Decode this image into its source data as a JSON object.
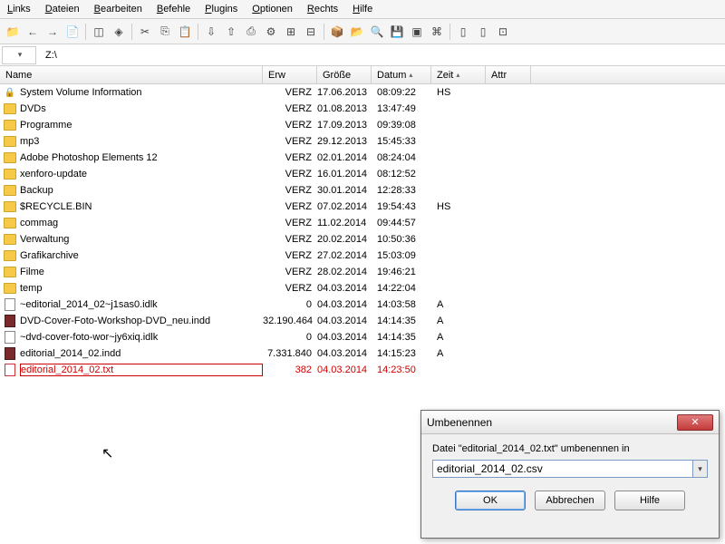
{
  "menu": [
    "Links",
    "Dateien",
    "Bearbeiten",
    "Befehle",
    "Plugins",
    "Optionen",
    "Rechts",
    "Hilfe"
  ],
  "drive": {
    "label": "",
    "path": "Z:\\"
  },
  "columns": {
    "name": "Name",
    "erw": "Erw",
    "size": "Größe",
    "date": "Datum",
    "time": "Zeit",
    "attr": "Attr"
  },
  "rows": [
    {
      "icon": "lock",
      "name": "System Volume Information",
      "size": "VERZ",
      "date": "17.06.2013",
      "time": "08:09:22",
      "attr": "HS"
    },
    {
      "icon": "folder",
      "name": "DVDs",
      "size": "VERZ",
      "date": "01.08.2013",
      "time": "13:47:49",
      "attr": ""
    },
    {
      "icon": "folder",
      "name": "Programme",
      "size": "VERZ",
      "date": "17.09.2013",
      "time": "09:39:08",
      "attr": ""
    },
    {
      "icon": "folder",
      "name": "mp3",
      "size": "VERZ",
      "date": "29.12.2013",
      "time": "15:45:33",
      "attr": ""
    },
    {
      "icon": "folder",
      "name": "Adobe Photoshop Elements 12",
      "size": "VERZ",
      "date": "02.01.2014",
      "time": "08:24:04",
      "attr": ""
    },
    {
      "icon": "folder",
      "name": "xenforo-update",
      "size": "VERZ",
      "date": "16.01.2014",
      "time": "08:12:52",
      "attr": ""
    },
    {
      "icon": "folder",
      "name": "Backup",
      "size": "VERZ",
      "date": "30.01.2014",
      "time": "12:28:33",
      "attr": ""
    },
    {
      "icon": "folder",
      "name": "$RECYCLE.BIN",
      "size": "VERZ",
      "date": "07.02.2014",
      "time": "19:54:43",
      "attr": "HS"
    },
    {
      "icon": "folder",
      "name": "commag",
      "size": "VERZ",
      "date": "11.02.2014",
      "time": "09:44:57",
      "attr": ""
    },
    {
      "icon": "folder",
      "name": "Verwaltung",
      "size": "VERZ",
      "date": "20.02.2014",
      "time": "10:50:36",
      "attr": ""
    },
    {
      "icon": "folder",
      "name": "Grafikarchive",
      "size": "VERZ",
      "date": "27.02.2014",
      "time": "15:03:09",
      "attr": ""
    },
    {
      "icon": "folder",
      "name": "Filme",
      "size": "VERZ",
      "date": "28.02.2014",
      "time": "19:46:21",
      "attr": ""
    },
    {
      "icon": "folder",
      "name": "temp",
      "size": "VERZ",
      "date": "04.03.2014",
      "time": "14:22:04",
      "attr": ""
    },
    {
      "icon": "file",
      "name": "~editorial_2014_02~j1sas0.idlk",
      "size": "0",
      "date": "04.03.2014",
      "time": "14:03:58",
      "attr": "A"
    },
    {
      "icon": "indd",
      "name": "DVD-Cover-Foto-Workshop-DVD_neu.indd",
      "size": "32.190.464",
      "date": "04.03.2014",
      "time": "14:14:35",
      "attr": "A"
    },
    {
      "icon": "file",
      "name": "~dvd-cover-foto-wor~jy6xiq.idlk",
      "size": "0",
      "date": "04.03.2014",
      "time": "14:14:35",
      "attr": "A"
    },
    {
      "icon": "indd",
      "name": "editorial_2014_02.indd",
      "size": "7.331.840",
      "date": "04.03.2014",
      "time": "14:15:23",
      "attr": "A"
    },
    {
      "icon": "txt",
      "name": "editorial_2014_02.txt",
      "size": "382",
      "date": "04.03.2014",
      "time": "14:23:50",
      "attr": "",
      "selected": true,
      "focused": true
    }
  ],
  "dialog": {
    "title": "Umbenennen",
    "label": "Datei \"editorial_2014_02.txt\" umbenennen in",
    "value": "editorial_2014_02.csv",
    "ok": "OK",
    "cancel": "Abbrechen",
    "help": "Hilfe"
  }
}
